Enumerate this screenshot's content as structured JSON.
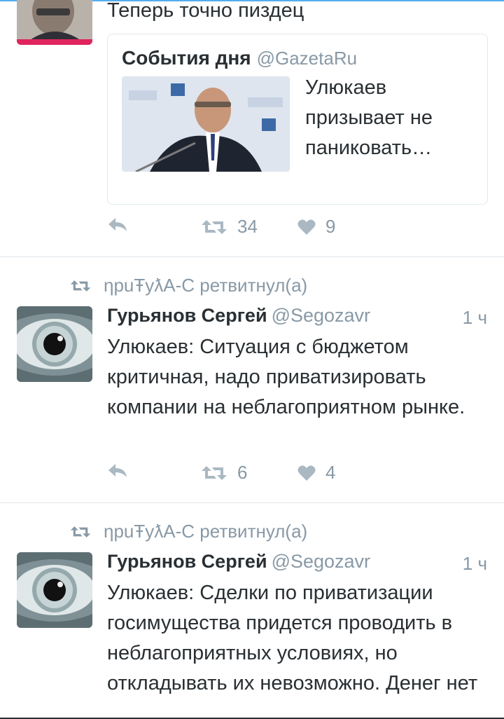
{
  "colors": {
    "accent": "#55acee",
    "muted": "#8899a6",
    "text": "#292f33",
    "border": "#e1e8ed"
  },
  "tweets": [
    {
      "text": "Теперь точно пиздец",
      "card": {
        "name": "События дня",
        "handle": "@GazetaRu",
        "title": "Улюкаев призывает не паниковать…"
      },
      "actions": {
        "retweets": "34",
        "likes": "9"
      }
    },
    {
      "retweeted_by": "ƞpuŦуƛA-C ретвитнул(а)",
      "name": "Гурьянов Сергей",
      "handle": "@Segozavr",
      "time": "1 ч",
      "text": "Улюкаев: Ситуация с бюджетом критичная, надо приватизировать компании на неблагоприятном рынке.",
      "actions": {
        "retweets": "6",
        "likes": "4"
      }
    },
    {
      "retweeted_by": "ƞpuŦуƛA-C ретвитнул(а)",
      "name": "Гурьянов Сергей",
      "handle": "@Segozavr",
      "time": "1 ч",
      "text": "Улюкаев: Сделки по приватизации госимущества придется проводить в неблагоприятных условиях, но откладывать их невозможно. Денег нет"
    }
  ],
  "icons": [
    "reply-icon",
    "retweet-icon",
    "like-icon"
  ]
}
